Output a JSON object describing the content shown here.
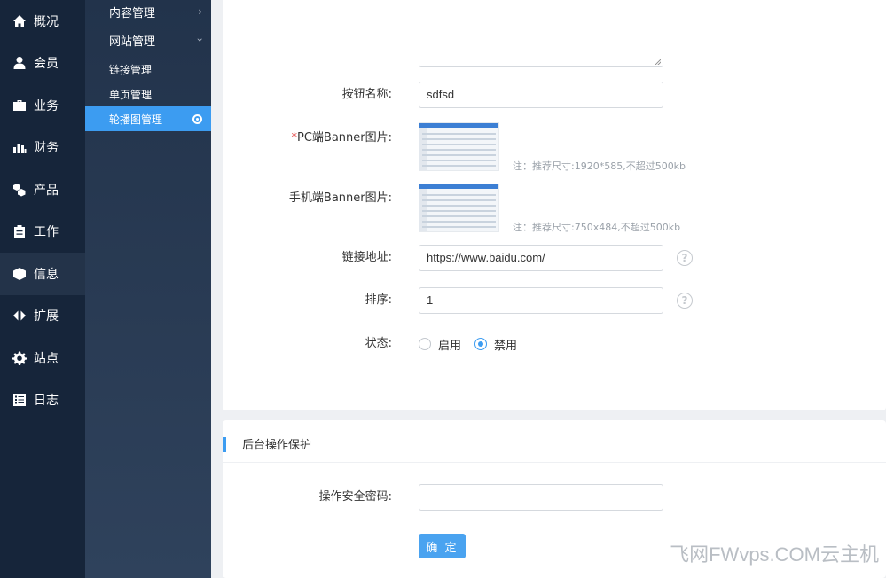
{
  "nav_primary": [
    {
      "label": "概况",
      "icon": "home-icon"
    },
    {
      "label": "会员",
      "icon": "user-icon"
    },
    {
      "label": "业务",
      "icon": "briefcase-icon"
    },
    {
      "label": "财务",
      "icon": "bar-chart-icon"
    },
    {
      "label": "产品",
      "icon": "cubes-icon"
    },
    {
      "label": "工作",
      "icon": "clipboard-icon"
    },
    {
      "label": "信息",
      "icon": "cube-icon",
      "active": true
    },
    {
      "label": "扩展",
      "icon": "arrows-icon"
    },
    {
      "label": "站点",
      "icon": "gear-icon"
    },
    {
      "label": "日志",
      "icon": "list-icon"
    }
  ],
  "nav_secondary": {
    "content_manage": "内容管理",
    "site_manage": "网站管理",
    "link_manage": "链接管理",
    "page_manage": "单页管理",
    "carousel_manage": "轮播图管理"
  },
  "form": {
    "button_name_label": "按钮名称:",
    "button_name_value": "sdfsd",
    "pc_banner_required": "*",
    "pc_banner_label": "PC端Banner图片:",
    "pc_banner_hint": "注：推荐尺寸:1920*585,不超过500kb",
    "mobile_banner_label": "手机端Banner图片:",
    "mobile_banner_hint": "注：推荐尺寸:750x484,不超过500kb",
    "link_label": "链接地址:",
    "link_value": "https://www.baidu.com/",
    "sort_label": "排序:",
    "sort_value": "1",
    "status_label": "状态:",
    "status_options": [
      "启用",
      "禁用"
    ],
    "status_selected": "禁用",
    "help_glyph": "?"
  },
  "protection": {
    "title": "后台操作保护",
    "password_label": "操作安全密码:",
    "password_value": "",
    "confirm_label": "确 定"
  },
  "watermark": "飞网FWvps.COM云主机",
  "colors": {
    "nav_bg": "#16253a",
    "accent": "#3c9cf1",
    "required": "#e23c3c"
  }
}
